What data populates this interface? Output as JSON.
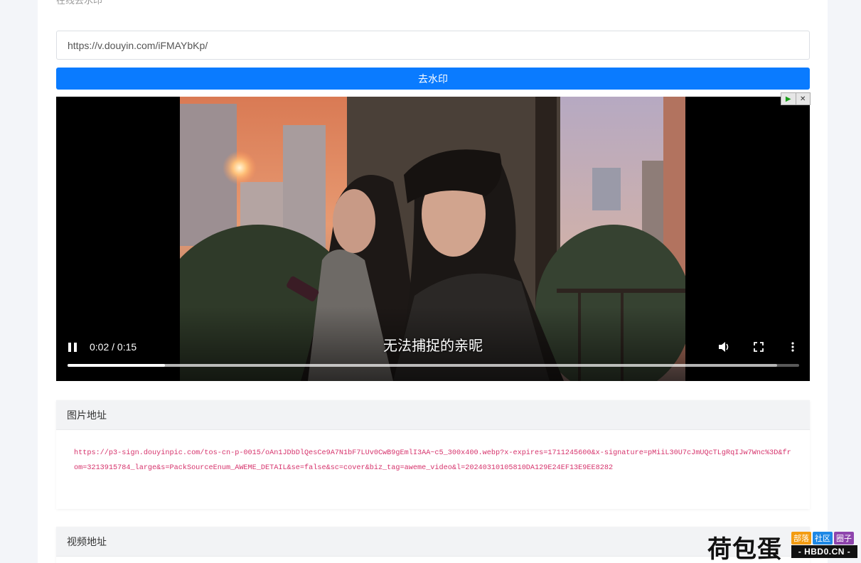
{
  "page": {
    "cut_title": "在线去水印"
  },
  "form": {
    "url_value": "https://v.douyin.com/iFMAYbKp/",
    "submit_label": "去水印"
  },
  "player": {
    "subtitle": "无法捕捉的亲昵",
    "current_time": "0:02",
    "duration": "0:15",
    "time_display": "0:02 / 0:15",
    "progress_fraction": 0.133,
    "buffer_fraction": 0.97,
    "icons": [
      "pause-icon",
      "volume-icon",
      "fullscreen-icon",
      "more-options-icon"
    ]
  },
  "ad_controls": {
    "play_symbol": "▶",
    "close_symbol": "✕"
  },
  "image_panel": {
    "title": "图片地址",
    "url": "https://p3-sign.douyinpic.com/tos-cn-p-0015/oAn1JDbDlQesCe9A7N1bF7LUv0CwB9gEmlI3AA~c5_300x400.webp?x-expires=1711245600&x-signature=pMiiL30U7cJmUQcTLgRqIJw7Wnc%3D&from=3213915784_large&s=PackSourceEnum_AWEME_DETAIL&se=false&sc=cover&biz_tag=aweme_video&l=20240310105810DA129E24EF13E9EE8282"
  },
  "video_panel": {
    "title": "视频地址"
  },
  "watermark_logo": {
    "main": "荷包蛋",
    "tags": [
      "部落",
      "社区",
      "圈子"
    ],
    "tag_colors": [
      "#f39c12",
      "#1e88e5",
      "#8e44ad"
    ],
    "sub": "- HBD0.CN -"
  },
  "colors": {
    "accent": "#0a7bff",
    "url_text": "#d6336c"
  }
}
